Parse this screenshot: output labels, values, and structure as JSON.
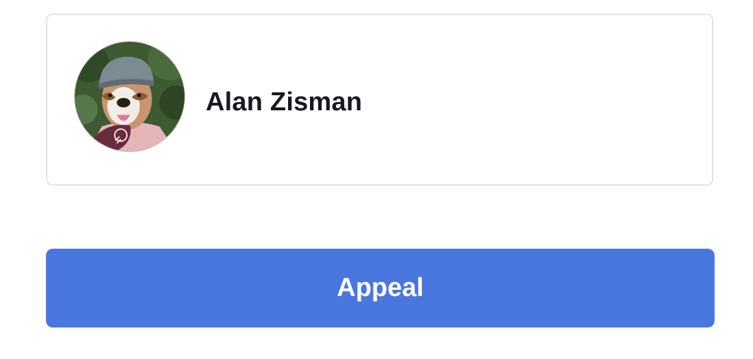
{
  "profile": {
    "name": "Alan Zisman",
    "avatar_icon": "user-avatar-photo"
  },
  "actions": {
    "appeal_label": "Appeal"
  },
  "colors": {
    "accent": "#4a77de",
    "name_text": "#161823",
    "card_border": "#e3e3e6"
  }
}
